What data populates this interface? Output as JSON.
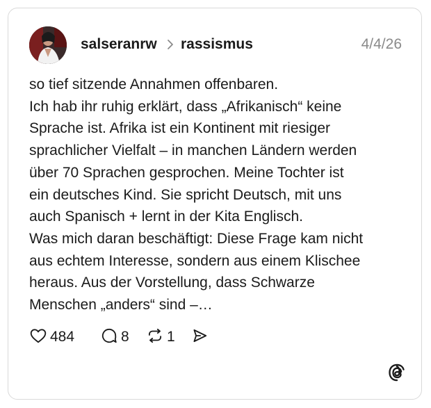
{
  "post": {
    "author": "salseranrw",
    "topic": "rassismus",
    "date": "4/4/26",
    "lines": [
      "so tief sitzende Annahmen offenbaren.",
      "Ich hab ihr ruhig erklärt, dass „Afrikanisch“ keine",
      "Sprache ist. Afrika ist ein Kontinent mit riesiger",
      "sprachlicher Vielfalt – in manchen Ländern werden",
      "über 70 Sprachen gesprochen. Meine Tochter ist",
      "ein deutsches Kind. Sie spricht Deutsch, mit uns",
      "auch Spanisch + lernt in der Kita Englisch.",
      "Was mich daran beschäftigt: Diese Frage kam nicht",
      "aus echtem Interesse, sondern aus einem Klischee",
      "heraus. Aus der Vorstellung, dass Schwarze",
      "Menschen „anders“ sind –…"
    ]
  },
  "actions": {
    "likes": "484",
    "replies": "8",
    "reposts": "1"
  },
  "icons": {
    "like": "heart-icon",
    "reply": "comment-icon",
    "repost": "repost-icon",
    "share": "send-icon",
    "brand": "threads-logo-icon",
    "separator": "chevron-right-icon"
  }
}
